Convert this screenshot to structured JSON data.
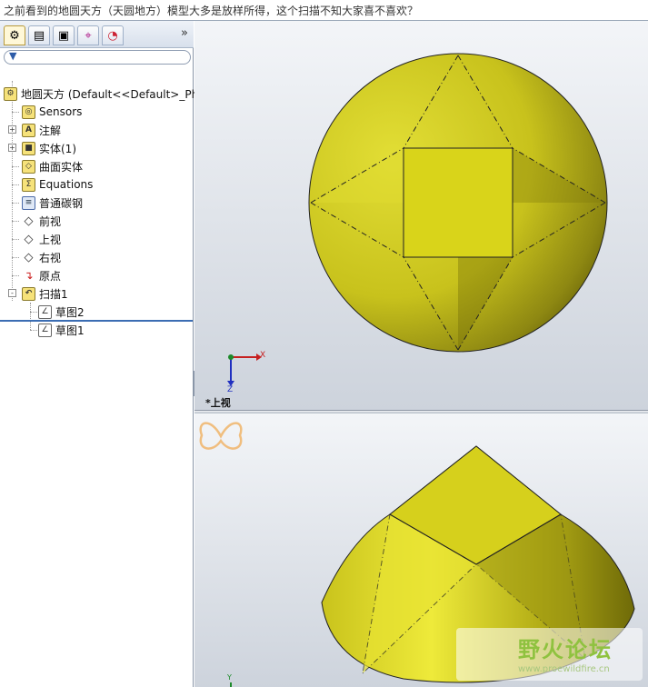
{
  "caption": "之前看到的地圆天方（天圆地方）模型大多是放样所得，这个扫描不知大家喜不喜欢？",
  "panel": {
    "tabs": [
      {
        "icon": "feature-manager-icon"
      },
      {
        "icon": "property-manager-icon"
      },
      {
        "icon": "configuration-manager-icon"
      },
      {
        "icon": "dimxpert-icon"
      },
      {
        "icon": "display-manager-icon"
      }
    ],
    "expand_label": "»",
    "filter_icon": "filter-icon"
  },
  "tree": {
    "root": "地圆天方  (Default<<Default>_Ph",
    "items": [
      {
        "label": "Sensors",
        "icon": "sensors-icon",
        "expander": ""
      },
      {
        "label": "注解",
        "icon": "annotations-icon",
        "expander": "+"
      },
      {
        "label": "实体(1)",
        "icon": "solid-bodies-icon",
        "expander": "+"
      },
      {
        "label": "曲面实体",
        "icon": "surface-bodies-icon",
        "expander": ""
      },
      {
        "label": "Equations",
        "icon": "equations-icon",
        "expander": ""
      },
      {
        "label": "普通碳钢",
        "icon": "material-icon",
        "expander": ""
      },
      {
        "label": "前视",
        "icon": "plane-icon",
        "expander": ""
      },
      {
        "label": "上视",
        "icon": "plane-icon",
        "expander": ""
      },
      {
        "label": "右视",
        "icon": "plane-icon",
        "expander": ""
      },
      {
        "label": "原点",
        "icon": "origin-icon",
        "expander": ""
      },
      {
        "label": "扫描1",
        "icon": "sweep-icon",
        "expander": "-"
      },
      {
        "label": "草图2",
        "icon": "sketch-icon",
        "expander": ""
      },
      {
        "label": "草图1",
        "icon": "sketch-icon",
        "expander": ""
      }
    ]
  },
  "viewport_top": {
    "view_label": "*上视",
    "triad": {
      "x": "X",
      "z": "Z"
    }
  },
  "viewport_bottom": {
    "triad": {
      "y": "Y"
    },
    "watermark": {
      "title": "野火论坛",
      "url": "www.proewildfire.cn"
    }
  },
  "colors": {
    "model_yellow": "#d8d420",
    "model_dark": "#8a8410",
    "tree_selection": "#3b6db3"
  }
}
